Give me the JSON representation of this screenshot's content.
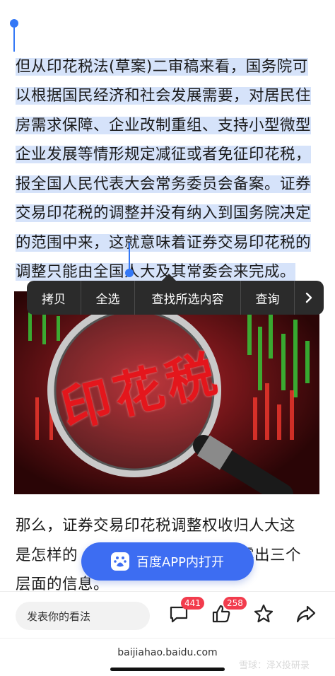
{
  "article": {
    "para1": "但从印花税法(草案)二审稿来看，国务院可以根据国民经济和社会发展需要，对居民住房需求保障、企业改制重组、支持小型微型企业发展等情形规定减征或者免征印花税，报全国人民代表大会常务委员会备案。证券交易印花税的调整并没有纳入到国务院决定的范围中来，这就意味着证券交易印花税的调整只能由全国人大及其常委会来完成。",
    "para2_line1": "那么，证券交易印花税调整权收归人大这",
    "para2_line2_start": "是怎样的",
    "para2_line2_end": "露出三个",
    "para2_line3": "层面的信息。"
  },
  "context_menu": {
    "items": [
      "拷贝",
      "全选",
      "查找所选内容",
      "查询"
    ],
    "more_icon": "chevron-right-icon"
  },
  "hero_image": {
    "title_text": "印花税"
  },
  "open_app_button": {
    "label": "百度APP内打开",
    "icon": "baidu-paw-icon"
  },
  "bottom_bar": {
    "comment_placeholder": "发表你的看法",
    "comment_count": "441",
    "like_count": "258",
    "icons": [
      "comment-icon",
      "like-icon",
      "star-icon",
      "share-icon"
    ]
  },
  "url_bar": {
    "url": "baijiahao.baidu.com"
  },
  "watermark": "雪球：泽X投研录",
  "colors": {
    "selection": "#d6e3fa",
    "handle": "#3478f6",
    "menu_bg": "#2b2b2b",
    "button_blue": "#3d6df2",
    "badge_red": "#f23c4d"
  }
}
